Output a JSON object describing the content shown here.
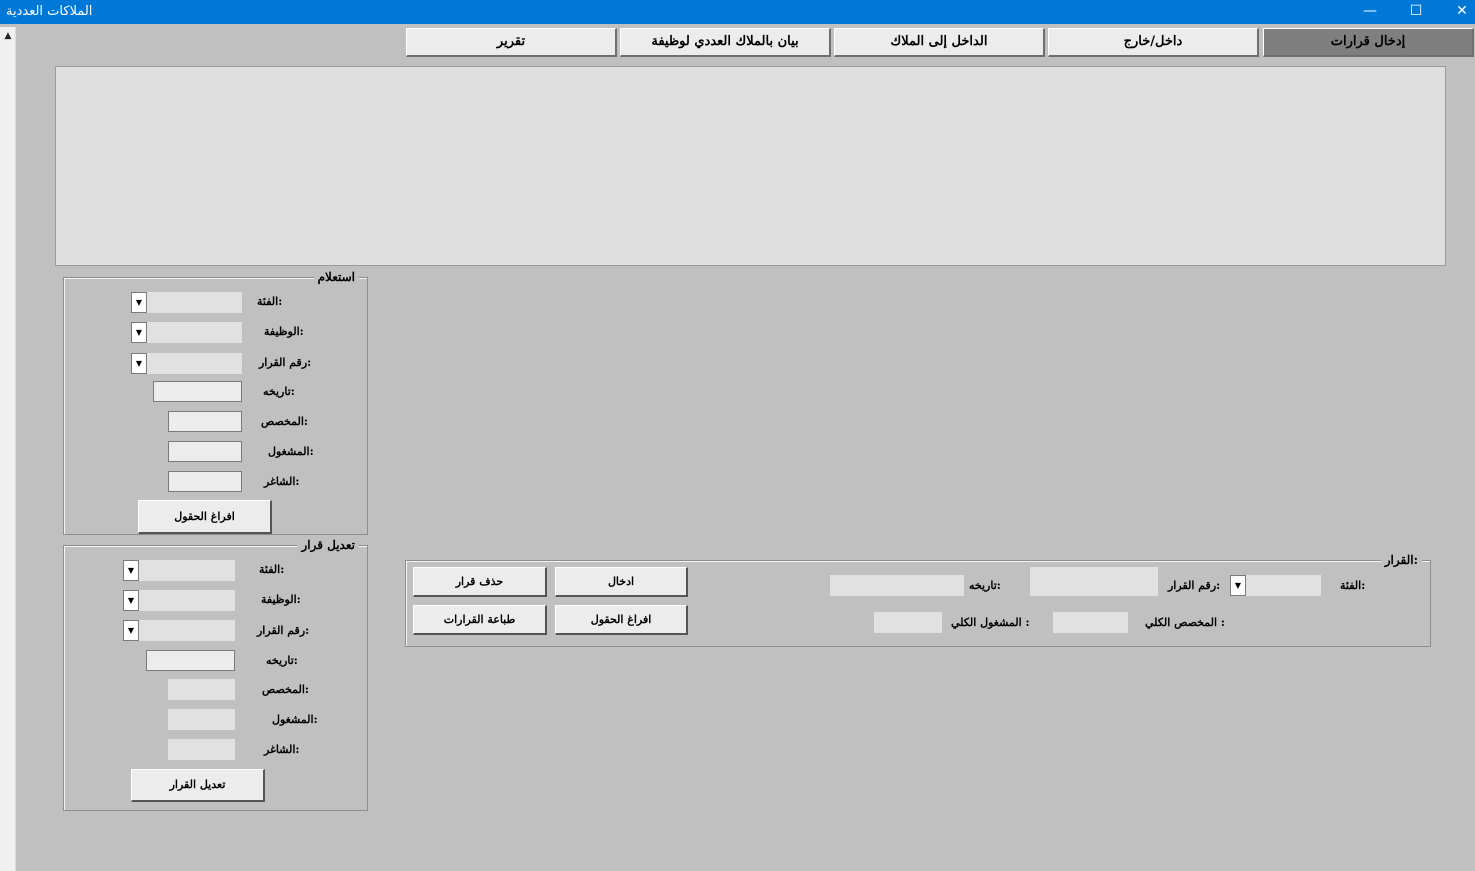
{
  "window": {
    "title": "الملاكات العددية",
    "minimize_glyph": "—",
    "maximize_glyph": "☐",
    "close_glyph": "✕"
  },
  "scroll": {
    "up_glyph": "▲"
  },
  "tabs": [
    {
      "label": "إدخال قرارات",
      "active": true
    },
    {
      "label": "داخل/خارج",
      "active": false
    },
    {
      "label": "الداخل إلى الملاك",
      "active": false
    },
    {
      "label": "بيان بالملاك العددي لوظيفة",
      "active": false
    },
    {
      "label": "تقرير",
      "active": false
    }
  ],
  "query": {
    "legend": "استعلام",
    "category_label": "الفئة:",
    "job_label": "الوظيفة:",
    "decision_no_label": "رقم  القرار:",
    "date_label": "تاريخه:",
    "allocated_label": "المخصص:",
    "occupied_label": "المشغول:",
    "vacant_label": "الشاغر:",
    "clear_button": "افراغ الحقول"
  },
  "edit": {
    "legend": "تعديل قرار",
    "category_label": "الفئة:",
    "job_label": "الوظيفة:",
    "decision_no_label": "رقم القرار:",
    "date_label": "تاريخه:",
    "allocated_label": "المخصص:",
    "occupied_label": "المشغول:",
    "vacant_label": "الشاغر:",
    "edit_button": "تعديل القرار"
  },
  "decision": {
    "legend": "القرار:",
    "category_label": "الفئة:",
    "decision_no_label": "رقم القرار:",
    "date_label": "تاريخه:",
    "total_allocated_label": "المخصص الكلي :",
    "total_occupied_label": "المشغول الكلي :",
    "insert_button": "ادخال",
    "delete_button": "حذف قرار",
    "clear_button": "افراغ الحقول",
    "print_button": "طباعة القرارات"
  },
  "icons": {
    "dropdown_arrow": "▼"
  }
}
